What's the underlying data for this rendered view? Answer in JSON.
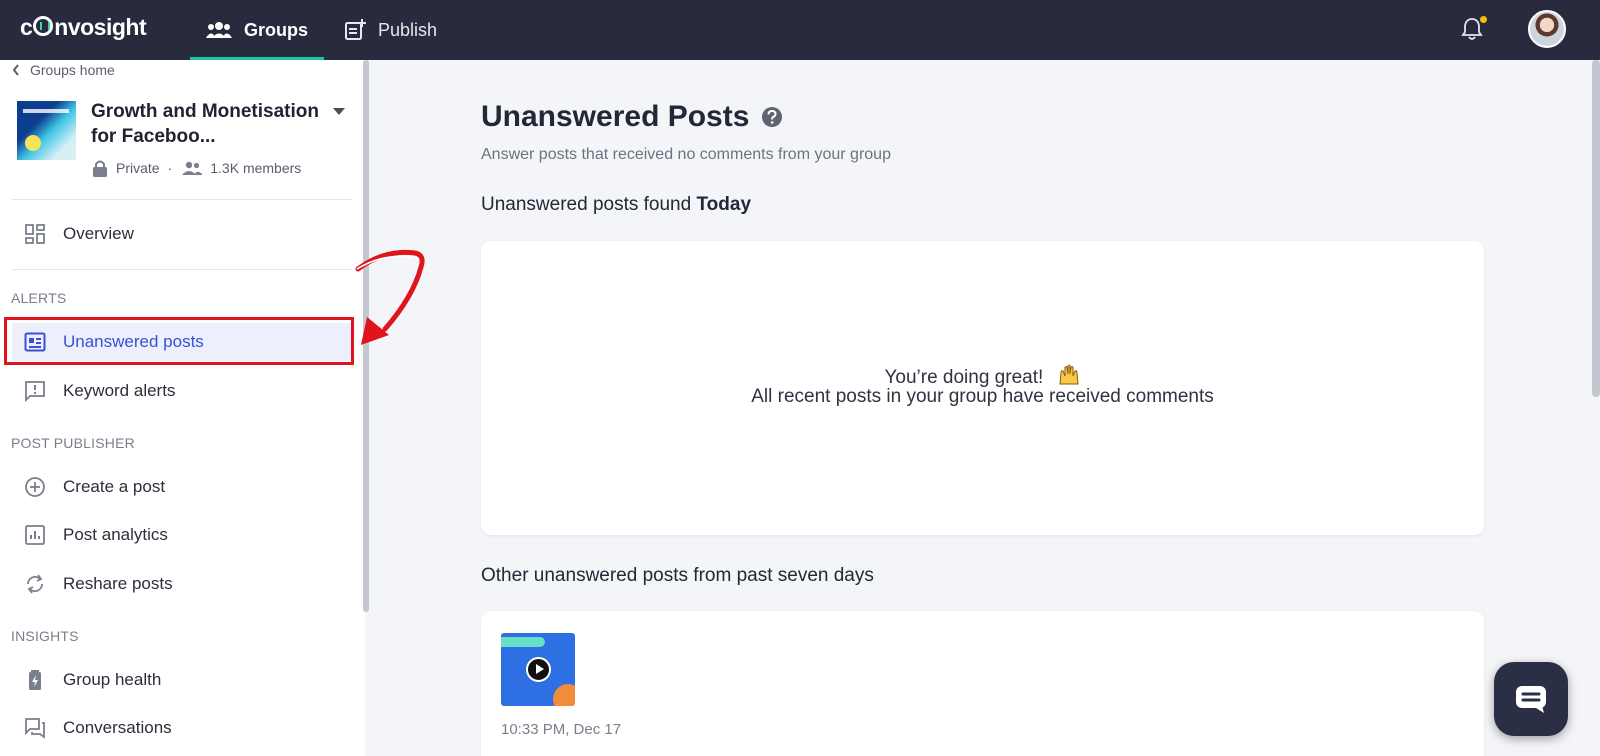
{
  "topbar": {
    "logo": "convosight",
    "tabs": [
      {
        "label": "Groups",
        "icon": "people-icon",
        "active": true
      },
      {
        "label": "Publish",
        "icon": "post-add-icon",
        "active": false
      }
    ],
    "accent": "#1fc7a0",
    "notification_dot_color": "#f5c000"
  },
  "sidebar": {
    "back_label": "Groups home",
    "group": {
      "name": "Growth and Monetisation for Faceboo...",
      "privacy": "Private",
      "separator": "·",
      "members": "1.3K members"
    },
    "overview_label": "Overview",
    "sections": {
      "alerts": "ALERTS",
      "post_publisher": "POST PUBLISHER",
      "insights": "INSIGHTS"
    },
    "items": {
      "unanswered": "Unanswered posts",
      "keyword": "Keyword alerts",
      "create": "Create a post",
      "analytics": "Post analytics",
      "reshare": "Reshare posts",
      "health": "Group health",
      "conversations": "Conversations"
    },
    "active_item": "Unanswered posts",
    "highlight_color": "#e0141c"
  },
  "main": {
    "title": "Unanswered Posts",
    "subtitle": "Answer posts that received no comments from your group",
    "today_prefix": "Unanswered posts found",
    "today_bold": "Today",
    "empty_line1": "You’re doing great!",
    "empty_line2": "All recent posts in your group have received comments",
    "past_heading": "Other unanswered posts from past seven days",
    "post": {
      "time": "10:33 PM, Dec 17"
    }
  }
}
